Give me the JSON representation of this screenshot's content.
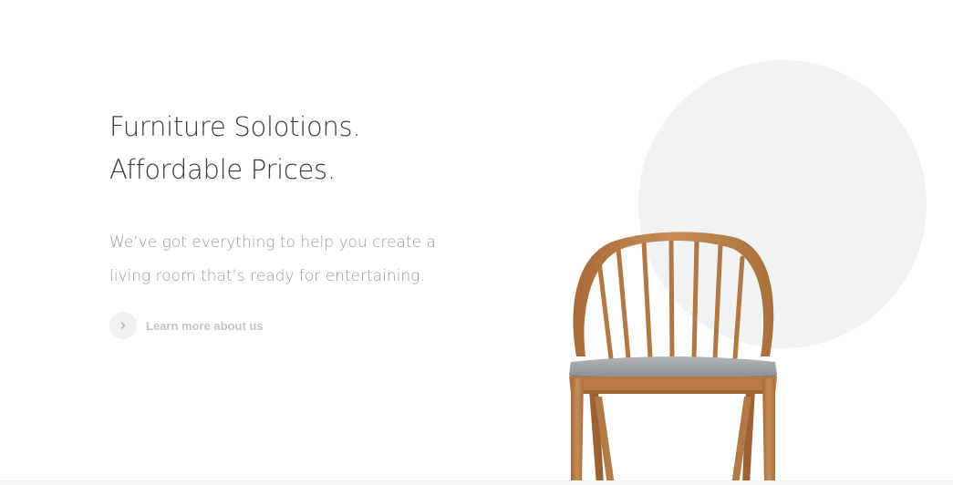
{
  "hero": {
    "headline_line1": "Furniture Solotions.",
    "headline_line2": "Affordable Prices.",
    "subtext_line1": "We’ve got everything to help you create a",
    "subtext_line2": "living room that’s ready for entertaining.",
    "cta_label": "Learn more about us",
    "cta_icon": "chevron-right-icon"
  },
  "image": {
    "subject": "chair-image",
    "backdrop_color": "#f0f3f2"
  },
  "colors": {
    "headline": "#3a3a3a",
    "subtext": "#9a9a9a",
    "cta_text": "#c4c4c4",
    "wood": "#b47a47",
    "seat": "#9c9fa2"
  }
}
